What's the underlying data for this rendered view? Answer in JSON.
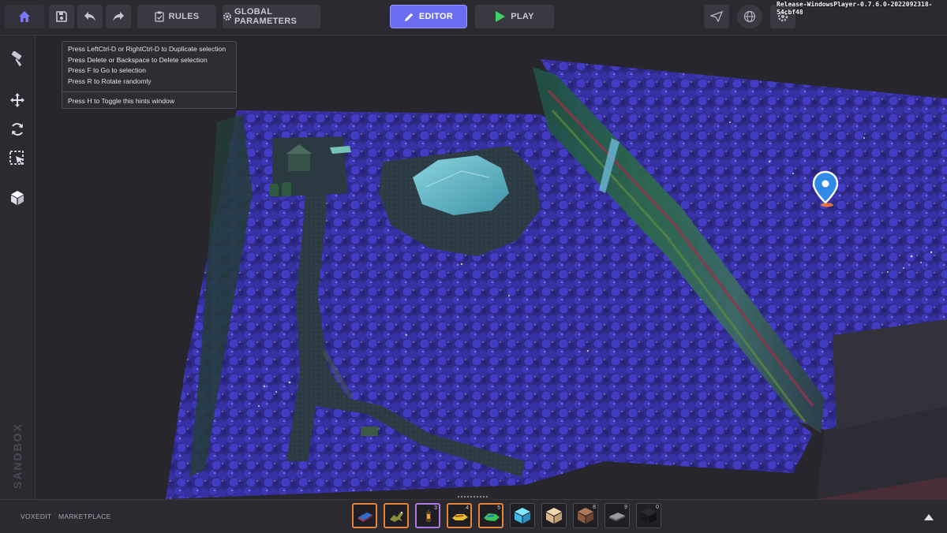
{
  "toolbar": {
    "rules_label": "RULES",
    "global_parameters_label": "GLOBAL PARAMETERS",
    "editor_label": "EDITOR",
    "play_label": "PLAY",
    "accent_color": "#6c6cf2",
    "icons": [
      "home-icon",
      "save-icon",
      "undo-icon",
      "redo-icon",
      "clipboard-check-icon",
      "gear-icon",
      "pencil-icon",
      "play-icon",
      "send-icon",
      "globe-icon",
      "settings-icon"
    ]
  },
  "version": "Release-WindowsPlayer-0.7.6.0-2022092318-54cbf48",
  "left_toolbar": {
    "icons": [
      "paint-roller-icon",
      "move-icon",
      "rotate-icon",
      "selection-icon",
      "cube-icon",
      "list-icon"
    ],
    "brand": "SANDBOX"
  },
  "hints": {
    "lines": [
      "Press LeftCtrl-D or RightCtrl-D to Duplicate selection",
      "Press Delete or Backspace to Delete selection",
      "Press F to Go to selection",
      "Press R to Rotate randomly"
    ],
    "toggle": "Press H to Toggle this hints window"
  },
  "bottom": {
    "voxedit_label": "VOXEDIT",
    "marketplace_label": "MARKETPLACE",
    "slots": [
      {
        "icon": "water-block-icon",
        "count": "",
        "frame": "orange"
      },
      {
        "icon": "dragon-icon",
        "count": "",
        "frame": "orange"
      },
      {
        "icon": "lantern-icon",
        "count": "3",
        "frame": "purple"
      },
      {
        "icon": "gold-vehicle-icon",
        "count": "4",
        "frame": "orange"
      },
      {
        "icon": "green-vehicle-icon",
        "count": "5",
        "frame": "orange"
      },
      {
        "icon": "ice-block-icon",
        "count": "",
        "frame": "none"
      },
      {
        "icon": "sand-block-icon",
        "count": "",
        "frame": "none"
      },
      {
        "icon": "dirt-block-icon",
        "count": "8",
        "frame": "none"
      },
      {
        "icon": "stone-slab-icon",
        "count": "9",
        "frame": "none"
      },
      {
        "icon": "obsidian-block-icon",
        "count": "0",
        "frame": "none"
      }
    ]
  }
}
